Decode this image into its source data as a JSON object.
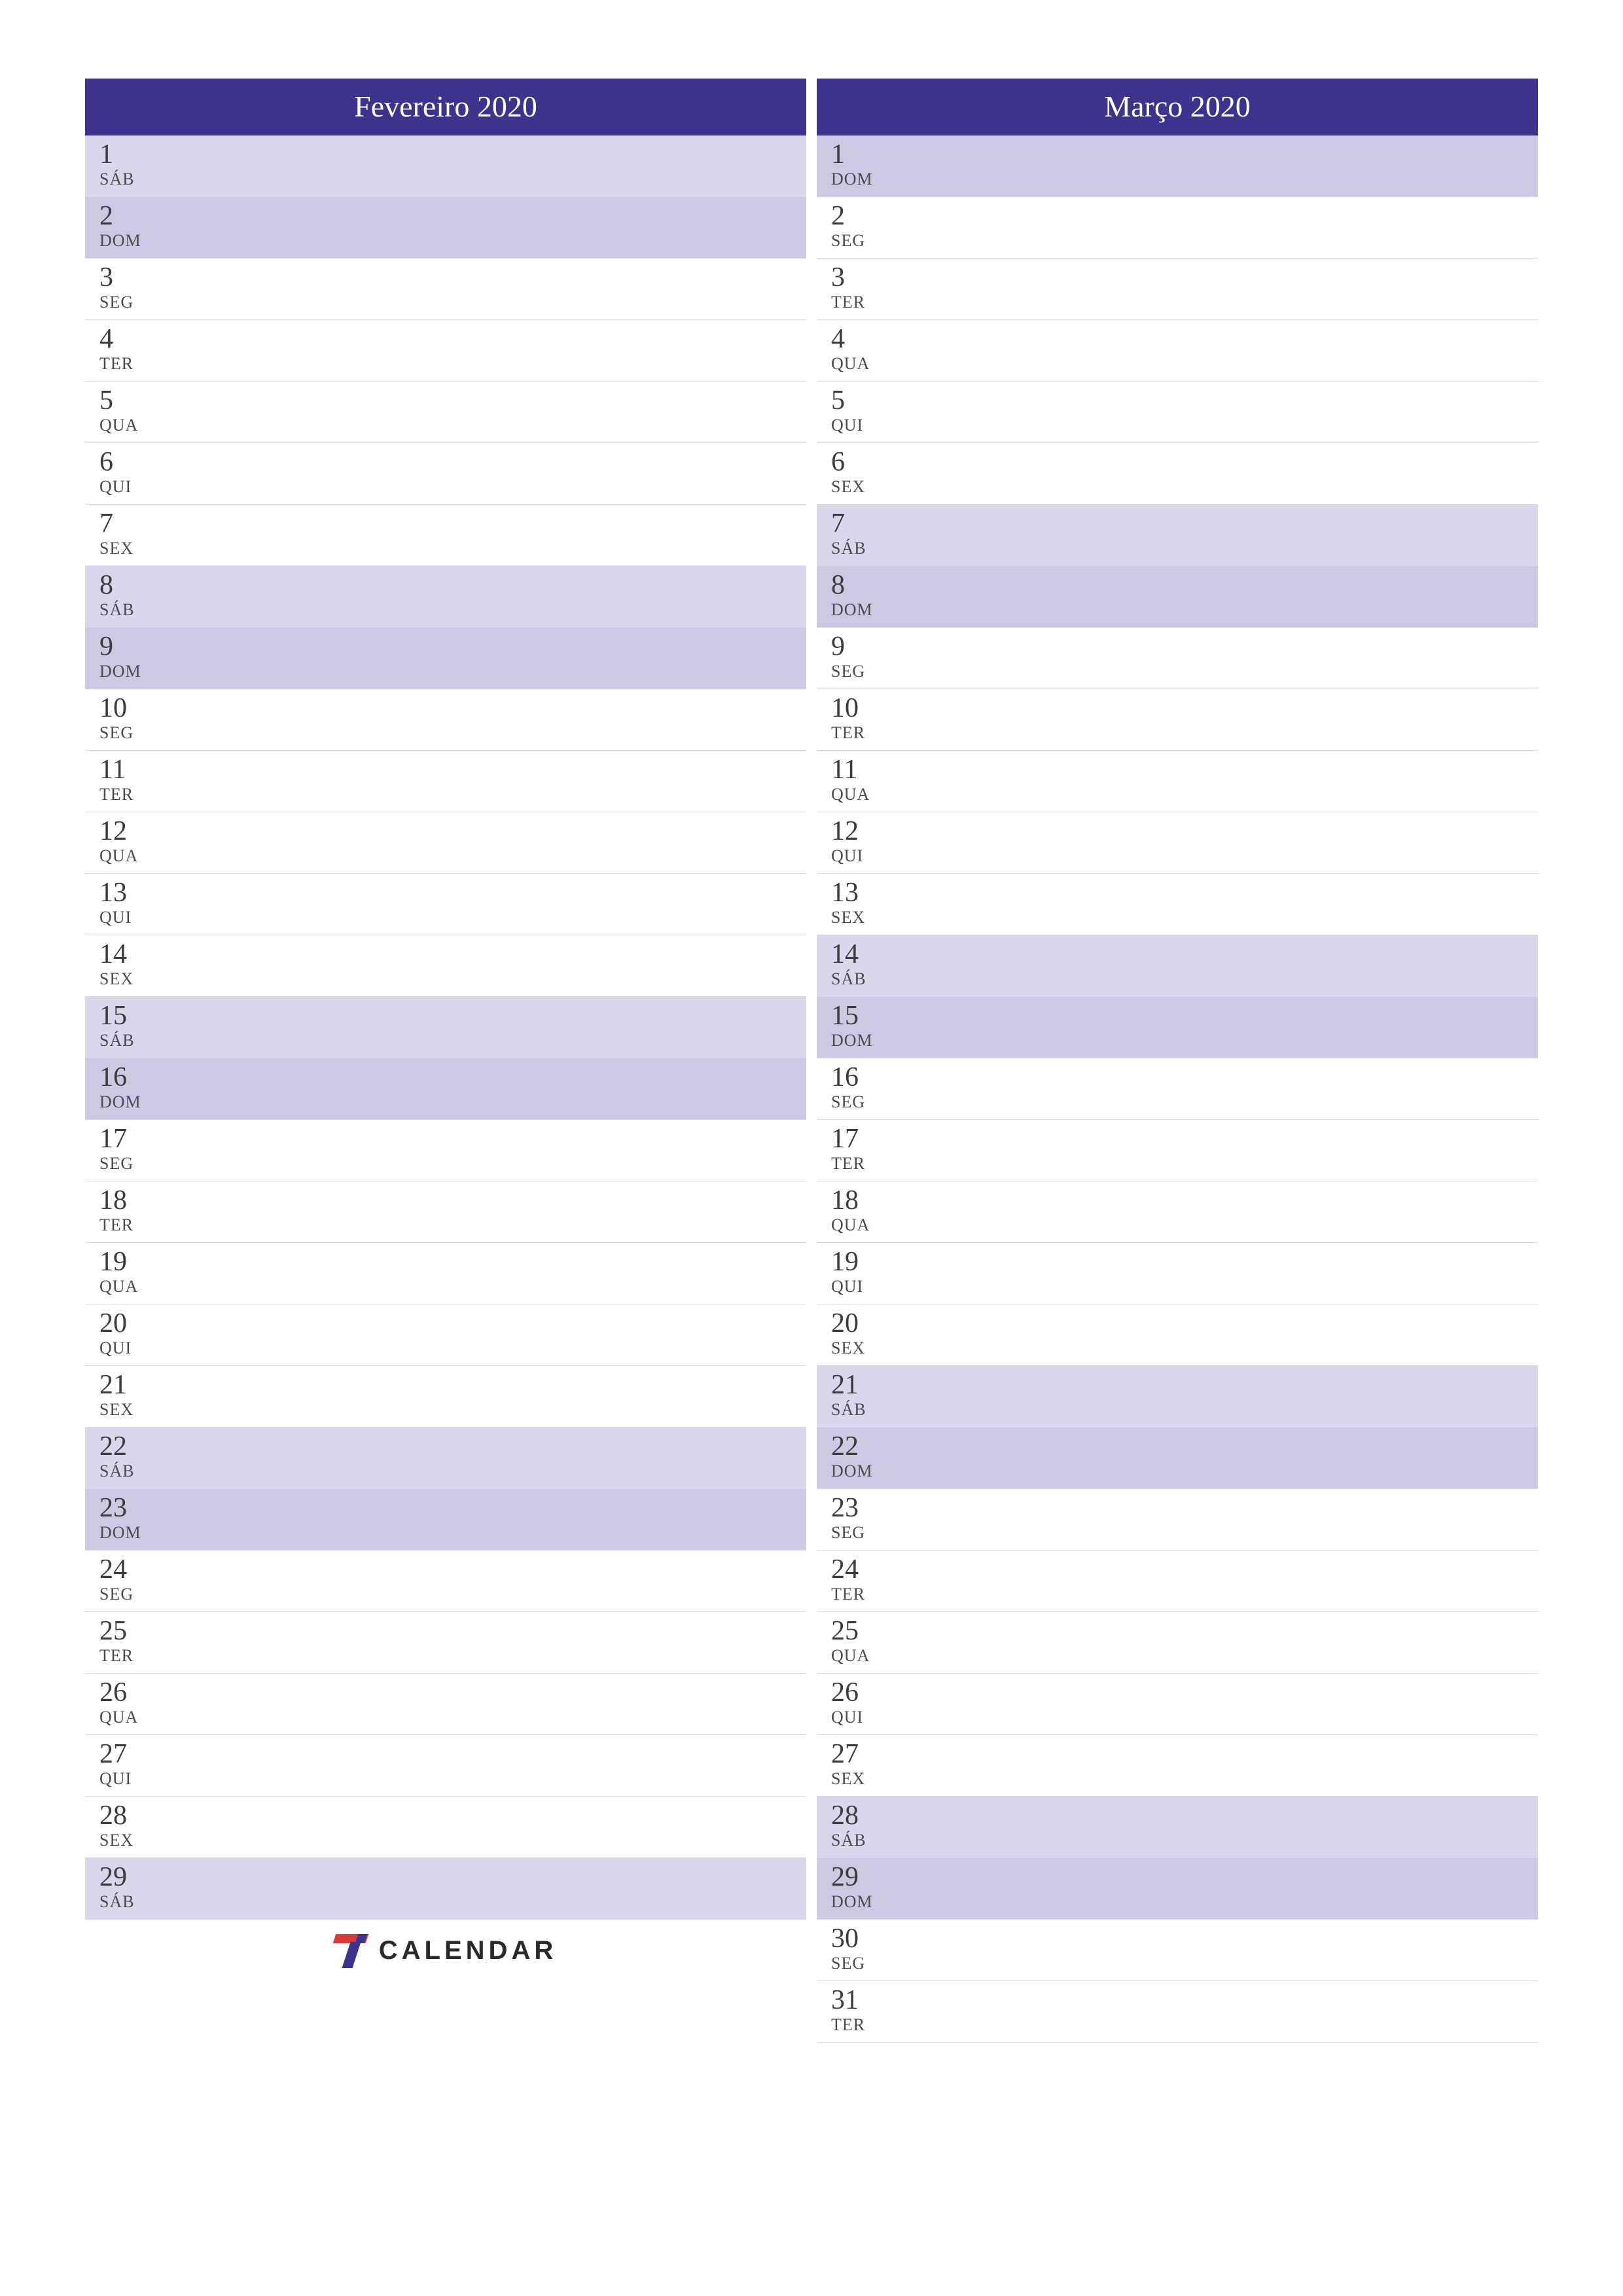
{
  "brand": {
    "name": "CALENDAR"
  },
  "months": [
    {
      "title": "Fevereiro 2020",
      "days": [
        {
          "num": "1",
          "abbr": "SÁB",
          "type": "saturday"
        },
        {
          "num": "2",
          "abbr": "DOM",
          "type": "sunday"
        },
        {
          "num": "3",
          "abbr": "SEG",
          "type": "weekday"
        },
        {
          "num": "4",
          "abbr": "TER",
          "type": "weekday"
        },
        {
          "num": "5",
          "abbr": "QUA",
          "type": "weekday"
        },
        {
          "num": "6",
          "abbr": "QUI",
          "type": "weekday"
        },
        {
          "num": "7",
          "abbr": "SEX",
          "type": "weekday"
        },
        {
          "num": "8",
          "abbr": "SÁB",
          "type": "saturday"
        },
        {
          "num": "9",
          "abbr": "DOM",
          "type": "sunday"
        },
        {
          "num": "10",
          "abbr": "SEG",
          "type": "weekday"
        },
        {
          "num": "11",
          "abbr": "TER",
          "type": "weekday"
        },
        {
          "num": "12",
          "abbr": "QUA",
          "type": "weekday"
        },
        {
          "num": "13",
          "abbr": "QUI",
          "type": "weekday"
        },
        {
          "num": "14",
          "abbr": "SEX",
          "type": "weekday"
        },
        {
          "num": "15",
          "abbr": "SÁB",
          "type": "saturday"
        },
        {
          "num": "16",
          "abbr": "DOM",
          "type": "sunday"
        },
        {
          "num": "17",
          "abbr": "SEG",
          "type": "weekday"
        },
        {
          "num": "18",
          "abbr": "TER",
          "type": "weekday"
        },
        {
          "num": "19",
          "abbr": "QUA",
          "type": "weekday"
        },
        {
          "num": "20",
          "abbr": "QUI",
          "type": "weekday"
        },
        {
          "num": "21",
          "abbr": "SEX",
          "type": "weekday"
        },
        {
          "num": "22",
          "abbr": "SÁB",
          "type": "saturday"
        },
        {
          "num": "23",
          "abbr": "DOM",
          "type": "sunday"
        },
        {
          "num": "24",
          "abbr": "SEG",
          "type": "weekday"
        },
        {
          "num": "25",
          "abbr": "TER",
          "type": "weekday"
        },
        {
          "num": "26",
          "abbr": "QUA",
          "type": "weekday"
        },
        {
          "num": "27",
          "abbr": "QUI",
          "type": "weekday"
        },
        {
          "num": "28",
          "abbr": "SEX",
          "type": "weekday"
        },
        {
          "num": "29",
          "abbr": "SÁB",
          "type": "saturday"
        }
      ]
    },
    {
      "title": "Março 2020",
      "days": [
        {
          "num": "1",
          "abbr": "DOM",
          "type": "sunday"
        },
        {
          "num": "2",
          "abbr": "SEG",
          "type": "weekday"
        },
        {
          "num": "3",
          "abbr": "TER",
          "type": "weekday"
        },
        {
          "num": "4",
          "abbr": "QUA",
          "type": "weekday"
        },
        {
          "num": "5",
          "abbr": "QUI",
          "type": "weekday"
        },
        {
          "num": "6",
          "abbr": "SEX",
          "type": "weekday"
        },
        {
          "num": "7",
          "abbr": "SÁB",
          "type": "saturday"
        },
        {
          "num": "8",
          "abbr": "DOM",
          "type": "sunday"
        },
        {
          "num": "9",
          "abbr": "SEG",
          "type": "weekday"
        },
        {
          "num": "10",
          "abbr": "TER",
          "type": "weekday"
        },
        {
          "num": "11",
          "abbr": "QUA",
          "type": "weekday"
        },
        {
          "num": "12",
          "abbr": "QUI",
          "type": "weekday"
        },
        {
          "num": "13",
          "abbr": "SEX",
          "type": "weekday"
        },
        {
          "num": "14",
          "abbr": "SÁB",
          "type": "saturday"
        },
        {
          "num": "15",
          "abbr": "DOM",
          "type": "sunday"
        },
        {
          "num": "16",
          "abbr": "SEG",
          "type": "weekday"
        },
        {
          "num": "17",
          "abbr": "TER",
          "type": "weekday"
        },
        {
          "num": "18",
          "abbr": "QUA",
          "type": "weekday"
        },
        {
          "num": "19",
          "abbr": "QUI",
          "type": "weekday"
        },
        {
          "num": "20",
          "abbr": "SEX",
          "type": "weekday"
        },
        {
          "num": "21",
          "abbr": "SÁB",
          "type": "saturday"
        },
        {
          "num": "22",
          "abbr": "DOM",
          "type": "sunday"
        },
        {
          "num": "23",
          "abbr": "SEG",
          "type": "weekday"
        },
        {
          "num": "24",
          "abbr": "TER",
          "type": "weekday"
        },
        {
          "num": "25",
          "abbr": "QUA",
          "type": "weekday"
        },
        {
          "num": "26",
          "abbr": "QUI",
          "type": "weekday"
        },
        {
          "num": "27",
          "abbr": "SEX",
          "type": "weekday"
        },
        {
          "num": "28",
          "abbr": "SÁB",
          "type": "saturday"
        },
        {
          "num": "29",
          "abbr": "DOM",
          "type": "sunday"
        },
        {
          "num": "30",
          "abbr": "SEG",
          "type": "weekday"
        },
        {
          "num": "31",
          "abbr": "TER",
          "type": "weekday"
        }
      ]
    }
  ]
}
